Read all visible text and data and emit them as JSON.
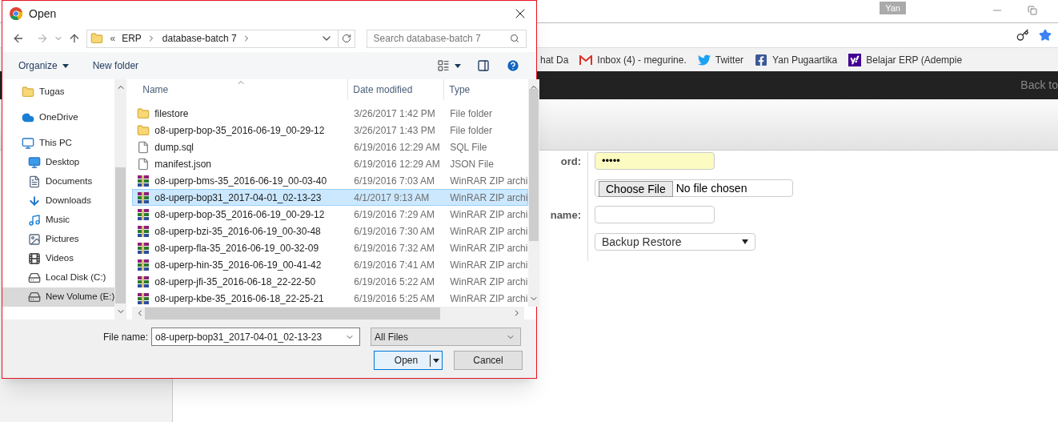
{
  "browser": {
    "profile": "Yan",
    "bookmarks": [
      {
        "label": "hat Da",
        "kind": "plain"
      },
      {
        "label": "Inbox (4) - megurine.",
        "kind": "gmail"
      },
      {
        "label": "Twitter",
        "kind": "twitter"
      },
      {
        "label": "Yan Pugaartika",
        "kind": "facebook"
      },
      {
        "label": "Belajar ERP (Adempie",
        "kind": "yahoo"
      }
    ],
    "nav_link": "Back to"
  },
  "form": {
    "fields": [
      {
        "label": "ord:",
        "kind": "password",
        "value": "•••••"
      },
      {
        "kind": "file",
        "button": "Choose File",
        "value": "No file chosen"
      },
      {
        "label": "name:",
        "kind": "text"
      },
      {
        "kind": "select",
        "value": "Backup Restore"
      }
    ]
  },
  "dialog": {
    "title": "Open",
    "overflow_mark": "«",
    "path": [
      "ERP",
      "database-batch 7"
    ],
    "search": {
      "placeholder": "Search database-batch 7"
    },
    "toolbar": {
      "organize": "Organize",
      "new_folder": "New folder"
    },
    "nav_pane": [
      {
        "label": "Tugas",
        "kind": "folder",
        "selected": false
      },
      {
        "label": "OneDrive",
        "kind": "cloud",
        "selected": false
      },
      {
        "label": "This PC",
        "kind": "pc",
        "selected": false,
        "children": [
          {
            "label": "Desktop",
            "kind": "desktop",
            "selected": false
          },
          {
            "label": "Documents",
            "kind": "documents",
            "selected": false
          },
          {
            "label": "Downloads",
            "kind": "downloads",
            "selected": false
          },
          {
            "label": "Music",
            "kind": "music",
            "selected": false
          },
          {
            "label": "Pictures",
            "kind": "pictures",
            "selected": false
          },
          {
            "label": "Videos",
            "kind": "videos",
            "selected": false
          },
          {
            "label": "Local Disk (C:)",
            "kind": "disk",
            "selected": false
          },
          {
            "label": "New Volume (E:)",
            "kind": "drive",
            "selected": true
          }
        ]
      }
    ],
    "columns": [
      "Name",
      "Date modified",
      "Type"
    ],
    "files": [
      {
        "kind": "folder",
        "name": "filestore",
        "date": "3/26/2017 1:42 PM",
        "type": "File folder",
        "selected": false
      },
      {
        "kind": "folder",
        "name": "o8-uperp-bop-35_2016-06-19_00-29-12",
        "date": "3/26/2017 1:43 PM",
        "type": "File folder",
        "selected": false
      },
      {
        "kind": "file",
        "name": "dump.sql",
        "date": "6/19/2016 12:29 AM",
        "type": "SQL File",
        "selected": false
      },
      {
        "kind": "file",
        "name": "manifest.json",
        "date": "6/19/2016 12:29 AM",
        "type": "JSON File",
        "selected": false
      },
      {
        "kind": "archive",
        "name": "o8-uperp-bms-35_2016-06-19_00-03-40",
        "date": "6/19/2016 7:03 AM",
        "type": "WinRAR ZIP archi",
        "selected": false
      },
      {
        "kind": "archive",
        "name": "o8-uperp-bop31_2017-04-01_02-13-23",
        "date": "4/1/2017 9:13 AM",
        "type": "WinRAR ZIP archi",
        "selected": true
      },
      {
        "kind": "archive",
        "name": "o8-uperp-bop-35_2016-06-19_00-29-12",
        "date": "6/19/2016 7:29 AM",
        "type": "WinRAR ZIP archi",
        "selected": false
      },
      {
        "kind": "archive",
        "name": "o8-uperp-bzi-35_2016-06-19_00-30-48",
        "date": "6/19/2016 7:30 AM",
        "type": "WinRAR ZIP archi",
        "selected": false
      },
      {
        "kind": "archive",
        "name": "o8-uperp-fla-35_2016-06-19_00-32-09",
        "date": "6/19/2016 7:32 AM",
        "type": "WinRAR ZIP archi",
        "selected": false
      },
      {
        "kind": "archive",
        "name": "o8-uperp-hin-35_2016-06-19_00-41-42",
        "date": "6/19/2016 7:41 AM",
        "type": "WinRAR ZIP archi",
        "selected": false
      },
      {
        "kind": "archive",
        "name": "o8-uperp-jfi-35_2016-06-18_22-22-50",
        "date": "6/19/2016 5:22 AM",
        "type": "WinRAR ZIP archi",
        "selected": false
      },
      {
        "kind": "archive",
        "name": "o8-uperp-kbe-35_2016-06-18_22-25-21",
        "date": "6/19/2016 5:25 AM",
        "type": "WinRAR ZIP archi",
        "selected": false
      }
    ],
    "file_name_label": "File name:",
    "file_name": "o8-uperp-bop31_2017-04-01_02-13-23",
    "filter": "All Files",
    "buttons": [
      "Open",
      "Cancel"
    ]
  }
}
